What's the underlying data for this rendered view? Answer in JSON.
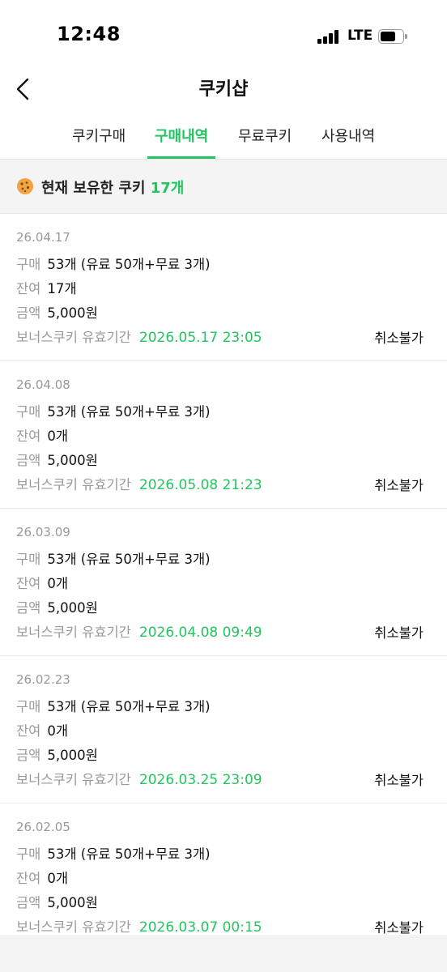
{
  "status_bar": {
    "time": "12:48",
    "network": "LTE",
    "icons": [
      "signal-icon",
      "battery-icon"
    ]
  },
  "header": {
    "title": "쿠키샵",
    "back_icon": "chevron-left-icon"
  },
  "tabs": [
    {
      "label": "쿠키구매",
      "active": false
    },
    {
      "label": "구매내역",
      "active": true
    },
    {
      "label": "무료쿠키",
      "active": false
    },
    {
      "label": "사용내역",
      "active": false
    }
  ],
  "balance": {
    "prefix": "현재 보유한 쿠키",
    "count": "17개",
    "icon": "cookie-icon"
  },
  "labels": {
    "qty": "구매",
    "remain": "잔여",
    "amount": "금액",
    "bonus": "보너스쿠키 유효기간"
  },
  "purchases": [
    {
      "date": "26.04.17",
      "qty": "53개 (유료 50개+무료 3개)",
      "remain": "17개",
      "amount": "5,000원",
      "bonus_expiry": "2026.05.17 23:05",
      "status": "취소불가"
    },
    {
      "date": "26.04.08",
      "qty": "53개 (유료 50개+무료 3개)",
      "remain": "0개",
      "amount": "5,000원",
      "bonus_expiry": "2026.05.08 21:23",
      "status": "취소불가"
    },
    {
      "date": "26.03.09",
      "qty": "53개 (유료 50개+무료 3개)",
      "remain": "0개",
      "amount": "5,000원",
      "bonus_expiry": "2026.04.08 09:49",
      "status": "취소불가"
    },
    {
      "date": "26.02.23",
      "qty": "53개 (유료 50개+무료 3개)",
      "remain": "0개",
      "amount": "5,000원",
      "bonus_expiry": "2026.03.25 23:09",
      "status": "취소불가"
    },
    {
      "date": "26.02.05",
      "qty": "53개 (유료 50개+무료 3개)",
      "remain": "0개",
      "amount": "5,000원",
      "bonus_expiry": "2026.03.07 00:15",
      "status": "취소불가"
    }
  ],
  "colors": {
    "accent": "#22c55e",
    "muted_text": "#9a9a9a",
    "balance_bg": "#f4f4f4"
  }
}
